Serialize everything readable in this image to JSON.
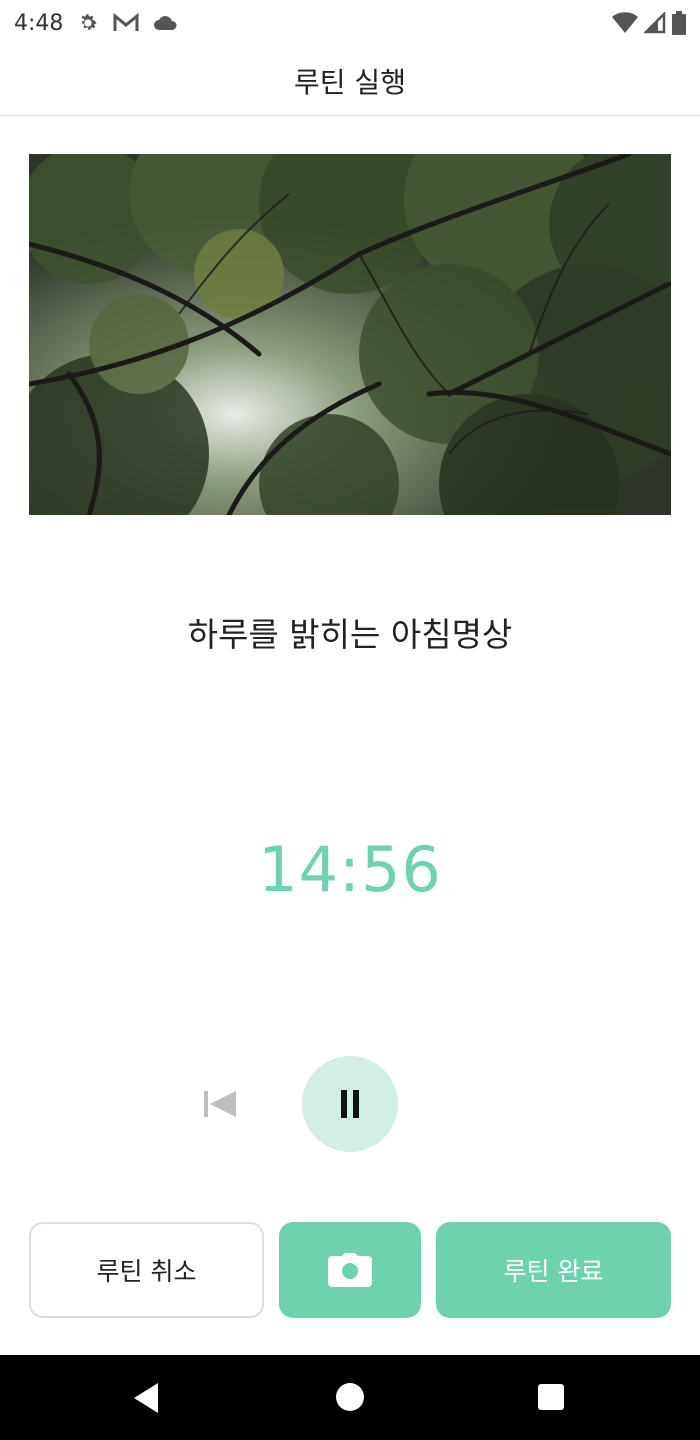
{
  "status_bar": {
    "time": "4:48",
    "icons": [
      "gear-icon",
      "gmail-icon",
      "cloud-icon",
      "wifi-icon",
      "signal-icon",
      "battery-icon"
    ]
  },
  "app_bar": {
    "title": "루틴 실행"
  },
  "hero_image": {
    "description_icon": "forest-canopy-image"
  },
  "routine": {
    "title": "하루를 밝히는 아침명상"
  },
  "timer": {
    "value": "14:56",
    "color": "#6ed3ad"
  },
  "controls": {
    "prev_icon": "skip-previous-icon",
    "pause_icon": "pause-icon"
  },
  "buttons": {
    "cancel_label": "루틴 취소",
    "camera_icon": "camera-icon",
    "complete_label": "루틴 완료"
  },
  "colors": {
    "accent": "#6ed3ad",
    "accent_light": "#d3eee4"
  },
  "nav_bar": {
    "icons": [
      "back-icon",
      "home-icon",
      "recents-icon"
    ]
  }
}
